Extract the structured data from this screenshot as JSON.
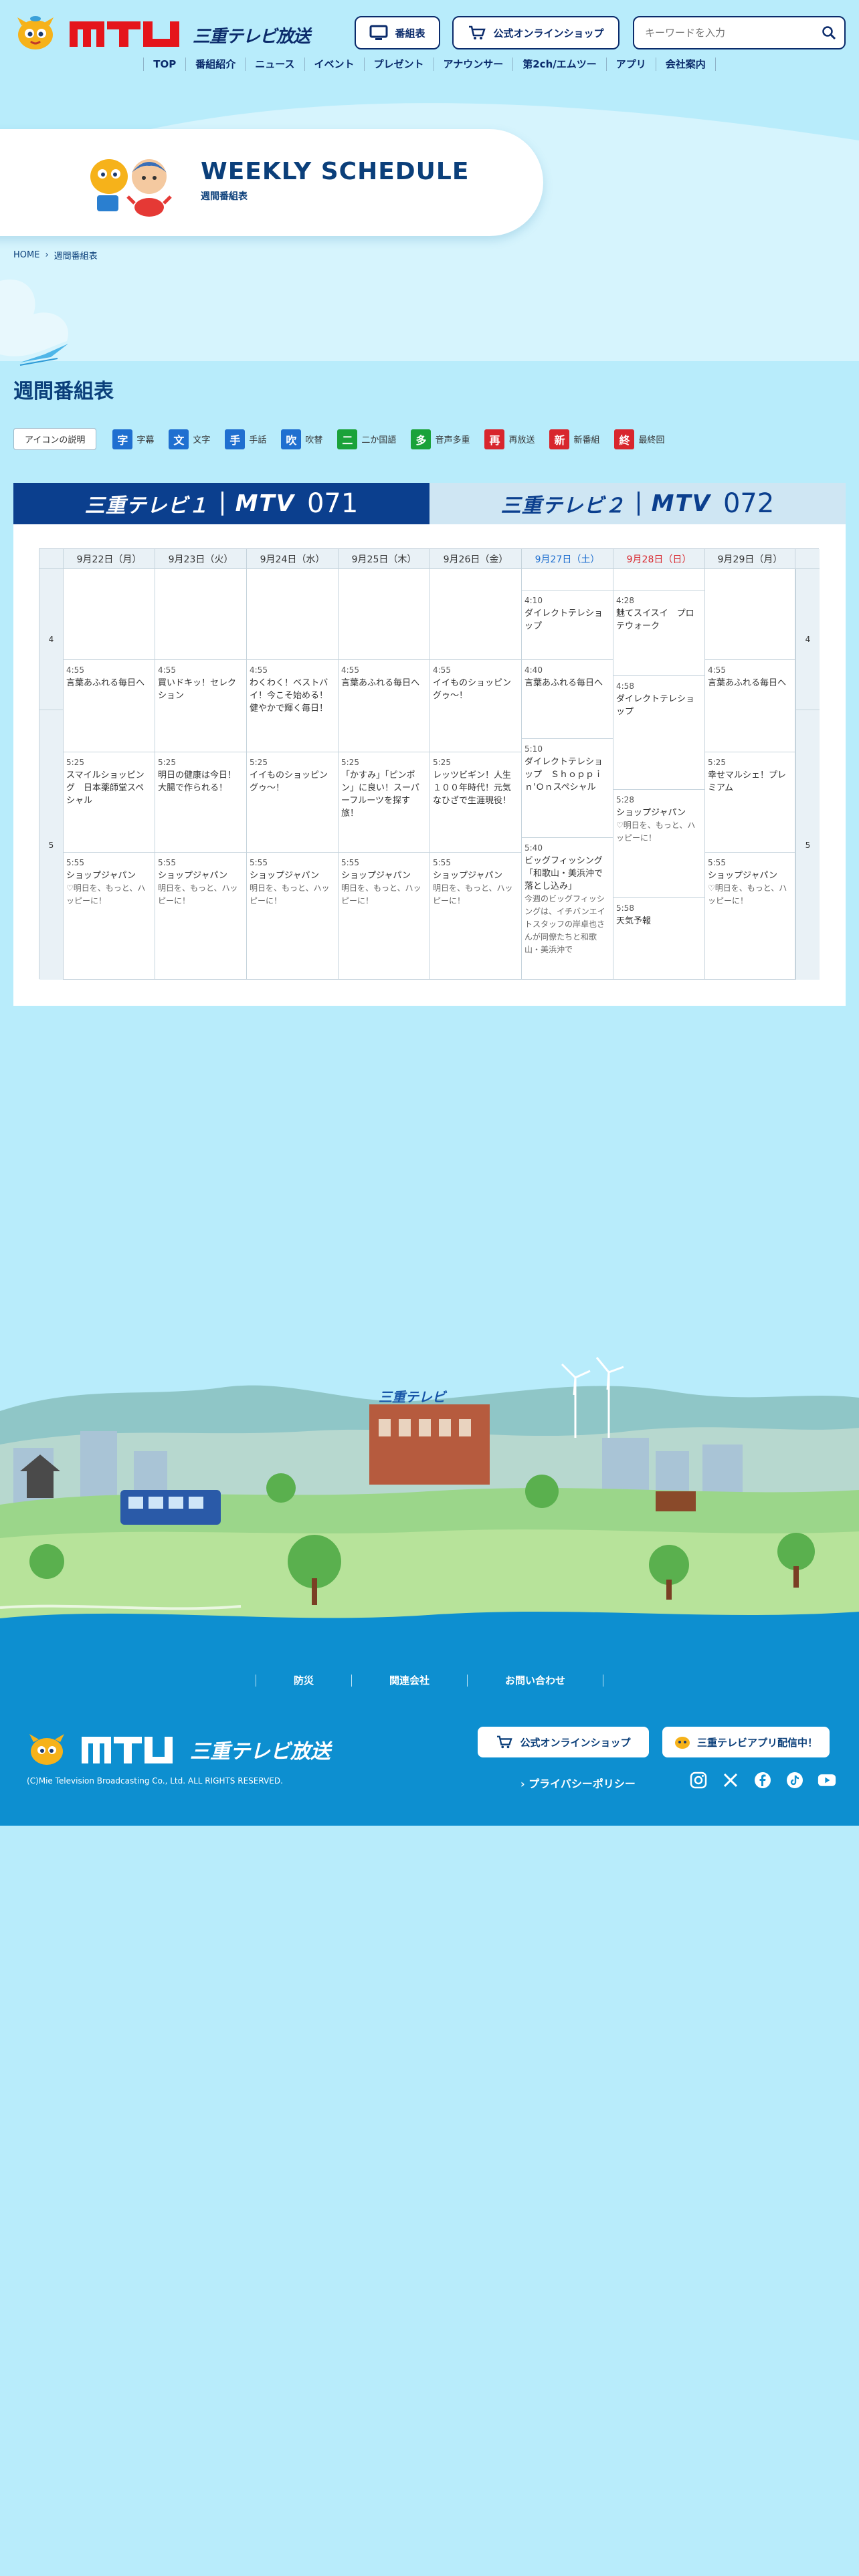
{
  "header": {
    "brand": "三重テレビ放送",
    "buttons": {
      "schedule": "番組表",
      "shop": "公式オンラインショップ"
    },
    "search_placeholder": "キーワードを入力",
    "nav": [
      "TOP",
      "番組紹介",
      "ニュース",
      "イベント",
      "プレゼント",
      "アナウンサー",
      "第2ch/エムツー",
      "アプリ",
      "会社案内"
    ]
  },
  "hero": {
    "title": "WEEKLY SCHEDULE",
    "subtitle": "週間番組表"
  },
  "breadcrumb": {
    "home": "HOME",
    "current": "週間番組表"
  },
  "page_title": "週間番組表",
  "legend": {
    "button": "アイコンの説明",
    "items": [
      {
        "mark": "字",
        "label": "字幕",
        "color": "#1f6fd0"
      },
      {
        "mark": "文",
        "label": "文字",
        "color": "#1f6fd0"
      },
      {
        "mark": "手",
        "label": "手話",
        "color": "#1f6fd0"
      },
      {
        "mark": "吹",
        "label": "吹替",
        "color": "#1f6fd0"
      },
      {
        "mark": "二",
        "label": "二か国語",
        "color": "#1aa23a"
      },
      {
        "mark": "多",
        "label": "音声多重",
        "color": "#1aa23a"
      },
      {
        "mark": "再",
        "label": "再放送",
        "color": "#d8262d"
      },
      {
        "mark": "新",
        "label": "新番組",
        "color": "#d8262d"
      },
      {
        "mark": "終",
        "label": "最終回",
        "color": "#d8262d"
      }
    ]
  },
  "channels": [
    {
      "name": "三重テレビ１",
      "logo": "MTV",
      "num": "071"
    },
    {
      "name": "三重テレビ２",
      "logo": "MTV",
      "num": "072"
    }
  ],
  "schedule": {
    "days": [
      {
        "label": "9月22日（月）",
        "color": "#333333"
      },
      {
        "label": "9月23日（火）",
        "color": "#333333"
      },
      {
        "label": "9月24日（水）",
        "color": "#333333"
      },
      {
        "label": "9月25日（木）",
        "color": "#333333"
      },
      {
        "label": "9月26日（金）",
        "color": "#333333"
      },
      {
        "label": "9月27日（土）",
        "color": "#1f6fd0"
      },
      {
        "label": "9月28日（日）",
        "color": "#d8262d"
      },
      {
        "label": "9月29日（月）",
        "color": "#333333"
      }
    ],
    "hours": [
      "4",
      "5"
    ],
    "programs": {
      "mon": [
        {
          "time": "4:55",
          "title": "言葉あふれる毎日へ"
        },
        {
          "time": "5:25",
          "title": "スマイルショッピング　日本薬師堂スペシャル"
        },
        {
          "time": "5:55",
          "title": "ショップジャパン",
          "sub": "♡明日を、もっと、ハッピーに！"
        }
      ],
      "tue": [
        {
          "time": "4:55",
          "title": "買いドキッ！セレクション"
        },
        {
          "time": "5:25",
          "title": "明日の健康は今日！大腸で作られる！"
        },
        {
          "time": "5:55",
          "title": "ショップジャパン",
          "sub": "明日を、もっと、ハッピーに！"
        }
      ],
      "wed": [
        {
          "time": "4:55",
          "title": "わくわく！ベストバイ！今こそ始める！健やかで輝く毎日！"
        },
        {
          "time": "5:25",
          "title": "イイものショッピングゥ〜！"
        },
        {
          "time": "5:55",
          "title": "ショップジャパン",
          "sub": "明日を、もっと、ハッピーに！"
        }
      ],
      "thu": [
        {
          "time": "4:55",
          "title": "言葉あふれる毎日へ"
        },
        {
          "time": "5:25",
          "title": "「かすみ」「ピンポン」に良い！スーパーフルーツを探す旅！"
        },
        {
          "time": "5:55",
          "title": "ショップジャパン",
          "sub": "明日を、もっと、ハッピーに！"
        }
      ],
      "fri": [
        {
          "time": "4:55",
          "title": "イイものショッピングゥ〜！"
        },
        {
          "time": "5:25",
          "title": "レッツビギン！人生１００年時代！元気なひざで生涯現役！"
        },
        {
          "time": "5:55",
          "title": "ショップジャパン",
          "sub": "明日を、もっと、ハッピーに！"
        }
      ],
      "sat": [
        {
          "time": "4:10",
          "title": "ダイレクトテレショップ"
        },
        {
          "time": "4:40",
          "title": "言葉あふれる毎日へ"
        },
        {
          "time": "5:10",
          "title": "ダイレクトテレショップ　Ｓｈｏｐｐｉｎ'Ｏｎスペシャル"
        },
        {
          "time": "5:40",
          "title": "ビッグフィッシング「和歌山・美浜沖で落とし込み」",
          "sub": "今週のビッグフィッシングは、イチバンエイトスタッフの岸卓也さんが同僚たちと和歌山・美浜沖で"
        }
      ],
      "sun": [
        {
          "time": "4:28",
          "title": "魅てスイスイ　プロテウォーク"
        },
        {
          "time": "4:58",
          "title": "ダイレクトテレショップ"
        },
        {
          "time": "5:28",
          "title": "ショップジャパン",
          "sub": "♡明日を、もっと、ハッピーに！"
        },
        {
          "time": "5:58",
          "title": "天気予報"
        }
      ],
      "mon2": [
        {
          "time": "4:55",
          "title": "言葉あふれる毎日へ"
        },
        {
          "time": "5:25",
          "title": "幸せマルシェ！プレミアム"
        },
        {
          "time": "5:55",
          "title": "ショップジャパン",
          "sub": "♡明日を、もっと、ハッピーに！"
        }
      ]
    }
  },
  "footer": {
    "art_sign": "三重テレビ",
    "nav": [
      "防災",
      "関連会社",
      "お問い合わせ"
    ],
    "brand": "三重テレビ放送",
    "copyright": "(C)Mie Television Broadcasting Co., Ltd. ALL RIGHTS RESERVED.",
    "shop_button": "公式オンラインショップ",
    "app_button": "三重テレビアプリ配信中！",
    "privacy": "プライバシーポリシー",
    "social": [
      "instagram-icon",
      "x-icon",
      "facebook-icon",
      "tiktok-icon",
      "youtube-icon"
    ]
  }
}
